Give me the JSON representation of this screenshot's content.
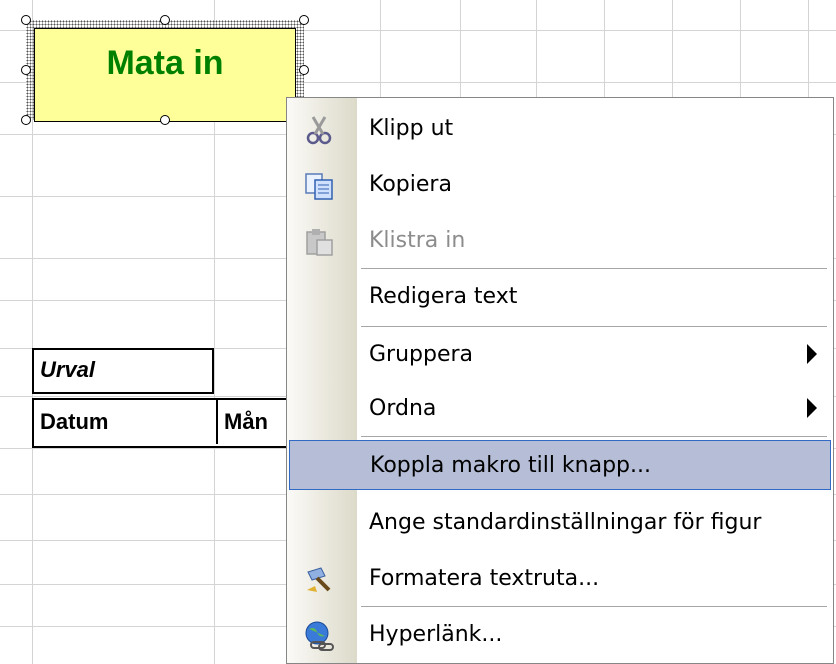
{
  "worksheet": {
    "macro_button_label": "Mata in",
    "urval_label": "Urval",
    "header_cells": [
      "Datum",
      "Mån"
    ]
  },
  "context_menu": {
    "items": [
      {
        "label": "Klipp ut",
        "accesskey": "K",
        "icon": "scissors-icon",
        "enabled": true
      },
      {
        "label": "Kopiera",
        "accesskey": "o",
        "icon": "copy-icon",
        "enabled": true
      },
      {
        "label": "Klistra in",
        "accesskey": "i",
        "icon": "paste-icon",
        "enabled": false
      },
      {
        "label": "Redigera text",
        "accesskey": "x",
        "icon": "",
        "enabled": true
      },
      {
        "label": "Gruppera",
        "accesskey": "G",
        "icon": "",
        "enabled": true,
        "submenu": true
      },
      {
        "label": "Ordna",
        "accesskey": "r",
        "icon": "",
        "enabled": true,
        "submenu": true
      },
      {
        "label": "Koppla makro till knapp...",
        "accesskey": "m",
        "icon": "",
        "enabled": true,
        "highlighted": true
      },
      {
        "label": "Ange standardinställningar för figur",
        "accesskey": "A",
        "icon": "",
        "enabled": true
      },
      {
        "label": "Formatera textruta...",
        "accesskey": "t",
        "icon": "format-paint-icon",
        "enabled": true
      },
      {
        "label": "Hyperlänk...",
        "accesskey": "H",
        "icon": "hyperlink-globe-icon",
        "enabled": true
      }
    ]
  },
  "colors": {
    "button_fill": "#ffff99",
    "button_text": "#008000",
    "menu_highlight": "#b5bed6",
    "menu_highlight_border": "#316ac5"
  }
}
